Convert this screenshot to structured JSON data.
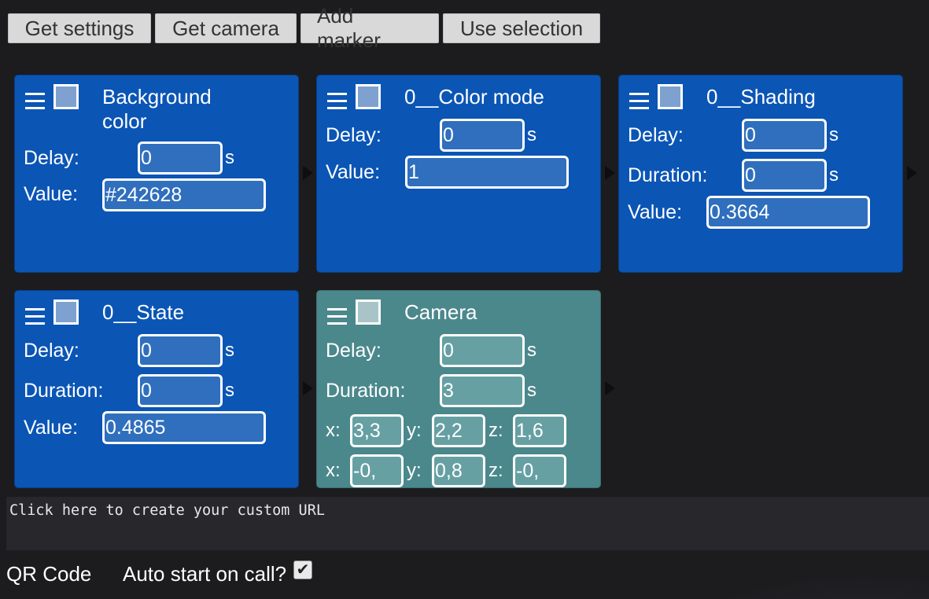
{
  "toolbar": {
    "buttons": [
      "Get settings",
      "Get camera",
      "Add marker",
      "Use selection"
    ]
  },
  "cards": [
    {
      "title": "Background color",
      "delay_label": "Delay:",
      "delay_value": "0",
      "delay_unit": "s",
      "value_label": "Value:",
      "value": "#242628"
    },
    {
      "title": "0__Color mode",
      "delay_label": "Delay:",
      "delay_value": "0",
      "delay_unit": "s",
      "value_label": "Value:",
      "value": "1"
    },
    {
      "title": "0__Shading",
      "delay_label": "Delay:",
      "delay_value": "0",
      "delay_unit": "s",
      "duration_label": "Duration:",
      "duration_value": "0",
      "duration_unit": "s",
      "value_label": "Value:",
      "value": "0.3664"
    },
    {
      "title": "0__State",
      "delay_label": "Delay:",
      "delay_value": "0",
      "delay_unit": "s",
      "duration_label": "Duration:",
      "duration_value": "0",
      "duration_unit": "s",
      "value_label": "Value:",
      "value": "0.4865"
    },
    {
      "title": "Camera",
      "delay_label": "Delay:",
      "delay_value": "0",
      "delay_unit": "s",
      "duration_label": "Duration:",
      "duration_value": "3",
      "duration_unit": "s",
      "position": {
        "x_label": "x:",
        "x": "3,3",
        "y_label": "y:",
        "y": "2,2",
        "z_label": "z:",
        "z": "1,6"
      },
      "target": {
        "x_label": "x:",
        "x": "-0,",
        "y_label": "y:",
        "y": "0,8",
        "z_label": "z:",
        "z": "-0,"
      }
    }
  ],
  "url_area": {
    "text": "Click here to create your custom URL"
  },
  "footer": {
    "qr_label": "QR Code",
    "autostart_label": "Auto start on call?",
    "autostart_checked": true,
    "checkmark_glyph": "✔"
  },
  "colors": {
    "background": "#1c1c1e",
    "card_blue": "#0b55b5",
    "card_camera": "#4b888c",
    "toolbar_button": "#d9d9d9"
  }
}
